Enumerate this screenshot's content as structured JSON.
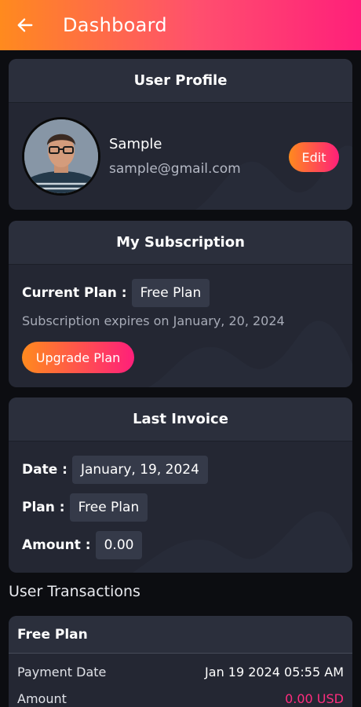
{
  "appbar": {
    "title": "Dashboard",
    "back_icon": "arrow-left-icon"
  },
  "profile": {
    "header": "User Profile",
    "name": "Sample",
    "email": "sample@gmail.com",
    "edit_label": "Edit",
    "avatar_icon": "user-avatar-photo"
  },
  "subscription": {
    "header": "My Subscription",
    "current_plan_label": "Current Plan :",
    "current_plan_value": "Free Plan",
    "expires_text": "Subscription expires on January,  20, 2024",
    "upgrade_label": "Upgrade Plan"
  },
  "invoice": {
    "header": "Last Invoice",
    "date_label": "Date :",
    "date_value": "January,  19, 2024",
    "plan_label": "Plan :",
    "plan_value": "Free Plan",
    "amount_label": "Amount :",
    "amount_value": "0.00"
  },
  "transactions": {
    "title": "User Transactions",
    "items": [
      {
        "plan": "Free Plan",
        "payment_date_label": "Payment Date",
        "payment_date_value": "Jan 19 2024 05:55 AM",
        "amount_label": "Amount",
        "amount_value": "0.00 USD"
      }
    ]
  },
  "colors": {
    "accent_start": "#ff8a1e",
    "accent_end": "#ff1f7a",
    "card_bg": "#242733",
    "page_bg": "#0c0d11",
    "amount_pink": "#ff2d7e"
  }
}
